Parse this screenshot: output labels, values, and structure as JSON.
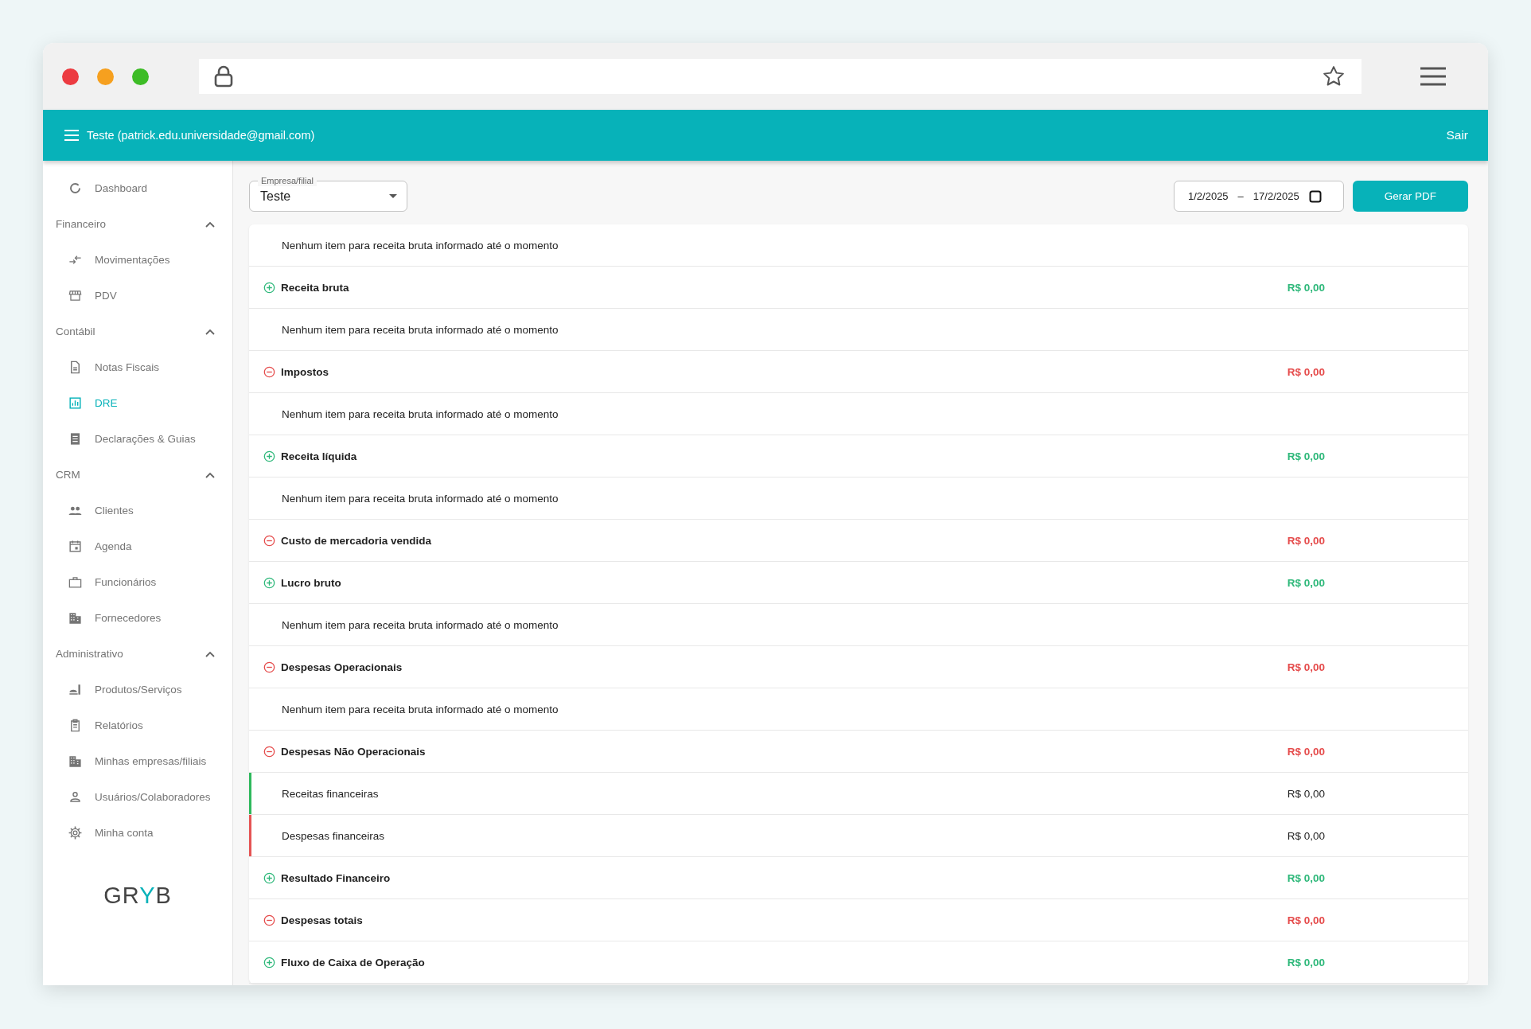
{
  "header": {
    "user": "Teste (patrick.edu.universidade@gmail.com)",
    "logout": "Sair"
  },
  "sidebar": {
    "items": [
      {
        "kind": "link",
        "label": "Dashboard",
        "selected": false
      },
      {
        "kind": "group",
        "label": "Financeiro",
        "expanded": true,
        "children": [
          {
            "label": "Movimentações",
            "selected": false
          },
          {
            "label": "PDV",
            "selected": false
          }
        ]
      },
      {
        "kind": "group",
        "label": "Contábil",
        "expanded": true,
        "children": [
          {
            "label": "Notas Fiscais",
            "selected": false
          },
          {
            "label": "DRE",
            "selected": true
          },
          {
            "label": "Declarações & Guias",
            "selected": false
          }
        ]
      },
      {
        "kind": "group",
        "label": "CRM",
        "expanded": true,
        "children": [
          {
            "label": "Clientes",
            "selected": false
          },
          {
            "label": "Agenda",
            "selected": false
          },
          {
            "label": "Funcionários",
            "selected": false
          },
          {
            "label": "Fornecedores",
            "selected": false
          }
        ]
      },
      {
        "kind": "group",
        "label": "Administrativo",
        "expanded": true,
        "children": [
          {
            "label": "Produtos/Serviços",
            "selected": false
          },
          {
            "label": "Relatórios",
            "selected": false
          },
          {
            "label": "Minhas empresas/filiais",
            "selected": false
          },
          {
            "label": "Usuários/Colaboradores",
            "selected": false
          },
          {
            "label": "Minha conta",
            "selected": false
          }
        ]
      }
    ],
    "logo": [
      {
        "text": "GR",
        "highlighted": false
      },
      {
        "text": "Y",
        "highlighted": true
      },
      {
        "text": "B",
        "highlighted": false
      }
    ]
  },
  "filters": {
    "company": {
      "label": "Empresa/filial",
      "value": "Teste"
    },
    "date_range": {
      "start": "1/2/2025",
      "separator": "–",
      "end": "17/2/2025"
    },
    "pdf_button": "Gerar PDF"
  },
  "rows": [
    {
      "kind": "note",
      "label": "Nenhum item para receita bruta informado até o momento"
    },
    {
      "kind": "total",
      "positive": true,
      "label": "Receita bruta",
      "amount": "R$ 0,00"
    },
    {
      "kind": "note",
      "label": "Nenhum item para receita bruta informado até o momento"
    },
    {
      "kind": "total",
      "positive": false,
      "label": "Impostos",
      "amount": "R$ 0,00"
    },
    {
      "kind": "note",
      "label": "Nenhum item para receita bruta informado até o momento"
    },
    {
      "kind": "total",
      "positive": true,
      "label": "Receita líquida",
      "amount": "R$ 0,00"
    },
    {
      "kind": "note",
      "label": "Nenhum item para receita bruta informado até o momento"
    },
    {
      "kind": "total",
      "positive": false,
      "label": "Custo de mercadoria vendida",
      "amount": "R$ 0,00"
    },
    {
      "kind": "total",
      "positive": true,
      "label": "Lucro bruto",
      "amount": "R$ 0,00"
    },
    {
      "kind": "note",
      "label": "Nenhum item para receita bruta informado até o momento"
    },
    {
      "kind": "total",
      "positive": false,
      "label": "Despesas Operacionais",
      "amount": "R$ 0,00"
    },
    {
      "kind": "note",
      "label": "Nenhum item para receita bruta informado até o momento"
    },
    {
      "kind": "total",
      "positive": false,
      "label": "Despesas Não Operacionais",
      "amount": "R$ 0,00"
    },
    {
      "kind": "item",
      "color": "#2eb85c",
      "label": "Receitas financeiras",
      "amount": "R$ 0,00"
    },
    {
      "kind": "item",
      "color": "#e55353",
      "label": "Despesas financeiras",
      "amount": "R$ 0,00"
    },
    {
      "kind": "total",
      "positive": true,
      "label": "Resultado Financeiro",
      "amount": "R$ 0,00"
    },
    {
      "kind": "total",
      "positive": false,
      "label": "Despesas totais",
      "amount": "R$ 0,00"
    },
    {
      "kind": "total",
      "positive": true,
      "label": "Fluxo de Caixa de Operação",
      "amount": "R$ 0,00"
    }
  ]
}
